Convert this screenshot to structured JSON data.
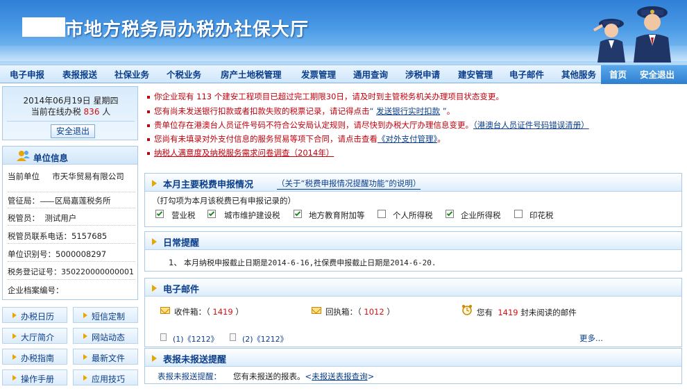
{
  "header": {
    "title": "市地方税务局办税办社保大厅"
  },
  "nav": {
    "items": [
      "电子申报",
      "表报报送",
      "社保业务",
      "个税业务",
      "房产土地税管理",
      "发票管理",
      "通用查询",
      "涉税申请",
      "建安管理",
      "电子邮件",
      "其他服务"
    ],
    "right_items": [
      "首页",
      "安全退出"
    ]
  },
  "session": {
    "date_line": "2014年06月19日 星期四",
    "online_prefix": "当前在线办税",
    "online_count": "836",
    "online_suffix": "人",
    "logout_label": "安全退出"
  },
  "unit_info": {
    "title": "单位信息",
    "rows": [
      {
        "label": "当前单位",
        "value": "市天华贸易有限公司"
      },
      {
        "label": "管征局：",
        "value": "区局嘉莲税务所"
      },
      {
        "label": "税管员：",
        "value": "测试用户"
      },
      {
        "label": "税管员联系电话：",
        "value": "5157685"
      },
      {
        "label": "单位识别号：",
        "value": "5000008297"
      },
      {
        "label": "税务登记证号：",
        "value": "350220000000001"
      },
      {
        "label": "企业档案编号：",
        "value": ""
      }
    ]
  },
  "quick_links": [
    "办税日历",
    "短信定制",
    "大厅简介",
    "网站动态",
    "办税指南",
    "最新文件",
    "操作手册",
    "应用技巧"
  ],
  "notices": {
    "n1": {
      "pre": "你企业现有",
      "num": "113",
      "post": "个建安工程项目已超过完工期限30日，请及时到主管税务机关办理项目状态变更。"
    },
    "n2": {
      "pre": "您有尚未发送银行扣款或者扣款失败的税票记录，请记得点击",
      "q1": "“",
      "link": "发送银行实时扣款",
      "q2": "”",
      "end": "。"
    },
    "n3": {
      "pre": "贵单位存在港澳台人员证件号码不符合公安局认定规则，请尽快到办税大厅办理信息变更。",
      "link": "（港澳台人员证件号码错误清册）"
    },
    "n4": {
      "pre": "您尚有未填录对外支付信息的服务贸易等项下合同，请点击查看",
      "link": "《对外支付管理》",
      "end": "。"
    },
    "n5": {
      "link": "纳税人满意度及纳税服务需求问卷调查（2014年）"
    }
  },
  "tax_panel": {
    "title": "本月主要税费申报情况",
    "link": "（关于“税费申报情况提醒功能”的说明）",
    "hint": "（打勾项为本月该税费已有申报记录的）",
    "items": [
      {
        "label": "营业税",
        "checked": true
      },
      {
        "label": "城市维护建设税",
        "checked": true
      },
      {
        "label": "地方教育附加等",
        "checked": true
      },
      {
        "label": "个人所得税",
        "checked": false
      },
      {
        "label": "企业所得税",
        "checked": true
      },
      {
        "label": "印花税",
        "checked": false
      }
    ]
  },
  "daily_panel": {
    "title": "日常提醒",
    "item_no": "1、",
    "item_text": "本月纳税申报截止日期是2014-6-16,社保费申报截止日期是2014-6-20."
  },
  "mail_panel": {
    "title": "电子邮件",
    "inbox_label": "收件箱：（",
    "inbox_count": "1419",
    "inbox_close": "）",
    "receipt_label": "回执箱：（",
    "receipt_count": "1012",
    "receipt_close": "）",
    "unread_pre": "您有",
    "unread_count": "1419",
    "unread_post": "封未阅读的邮件",
    "doc1": "(1)《1212》",
    "doc2": "(2)《1212》",
    "more": "更多..."
  },
  "report_panel": {
    "title": "表报未报送提醒",
    "label": "表报未报送提醒：",
    "text": "您有未报送的报表。",
    "link_open": "<",
    "link": "未报送表报查询",
    "link_close": ">"
  },
  "colors": {
    "nav_text": "#0b3e8a",
    "alert_red": "#c0000c",
    "accent_orange": "#e8a600"
  }
}
